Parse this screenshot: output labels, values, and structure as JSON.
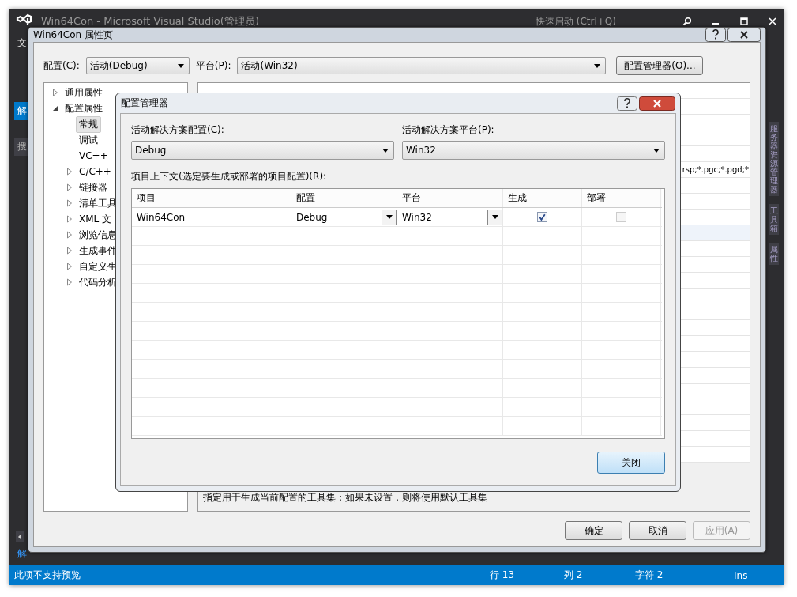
{
  "ide": {
    "title": "Win64Con - Microsoft Visual Studio(管理员)",
    "quick_launch": "快速启动 (Ctrl+Q)",
    "menu_partial": "文",
    "left_tabs": [
      {
        "label": "解",
        "selected": true
      },
      {
        "label": "搜",
        "selected": false
      }
    ],
    "left_bottom": "解",
    "right_tabs": [
      "服务器资源管理器",
      "工具箱",
      "属性"
    ]
  },
  "property_pages": {
    "title": "Win64Con 属性页",
    "config_label": "配置(C):",
    "config_value": "活动(Debug)",
    "platform_label": "平台(P):",
    "platform_value": "活动(Win32)",
    "config_manager_button": "配置管理器(O)...",
    "tree": [
      {
        "label": "通用属性",
        "kind": "group",
        "expanded": false,
        "selected": false
      },
      {
        "label": "配置属性",
        "kind": "group",
        "expanded": true,
        "selected": false,
        "children": [
          {
            "label": "常规",
            "kind": "leaf",
            "selected": true
          },
          {
            "label": "调试",
            "kind": "leaf",
            "selected": false
          },
          {
            "label": "VC++",
            "kind": "leaf",
            "selected": false
          },
          {
            "label": "C/C++",
            "kind": "group",
            "expanded": false,
            "selected": false
          },
          {
            "label": "链接器",
            "kind": "group",
            "expanded": false,
            "selected": false
          },
          {
            "label": "清单工具",
            "kind": "group",
            "expanded": false,
            "selected": false
          },
          {
            "label": "XML 文",
            "kind": "group",
            "expanded": false,
            "selected": false
          },
          {
            "label": "浏览信息",
            "kind": "group",
            "expanded": false,
            "selected": false
          },
          {
            "label": "生成事件",
            "kind": "group",
            "expanded": false,
            "selected": false
          },
          {
            "label": "自定义生",
            "kind": "group",
            "expanded": false,
            "selected": false
          },
          {
            "label": "代码分析",
            "kind": "group",
            "expanded": false,
            "selected": false
          }
        ]
      }
    ],
    "grid_value": "rsp;*.pgc;*.pgd;*",
    "description": "指定用于生成当前配置的工具集；如果未设置，则将使用默认工具集",
    "buttons": [
      {
        "label": "确定",
        "disabled": false
      },
      {
        "label": "取消",
        "disabled": false
      },
      {
        "label": "应用(A)",
        "disabled": true
      }
    ]
  },
  "config_manager": {
    "title": "配置管理器",
    "solution_config_label": "活动解决方案配置(C):",
    "solution_config_value": "Debug",
    "solution_platform_label": "活动解决方案平台(P):",
    "solution_platform_value": "Win32",
    "grid_label": "项目上下文(选定要生成或部署的项目配置)(R):",
    "columns": [
      "项目",
      "配置",
      "平台",
      "生成",
      "部署"
    ],
    "rows": [
      {
        "project": "Win64Con",
        "configuration": "Debug",
        "platform": "Win32",
        "build": true,
        "deploy": false
      }
    ],
    "close_button": "关闭"
  },
  "status_bar": {
    "message": "此项不支持预览",
    "line": "行 13",
    "column": "列 2",
    "char": "字符 2",
    "mode": "Ins"
  }
}
